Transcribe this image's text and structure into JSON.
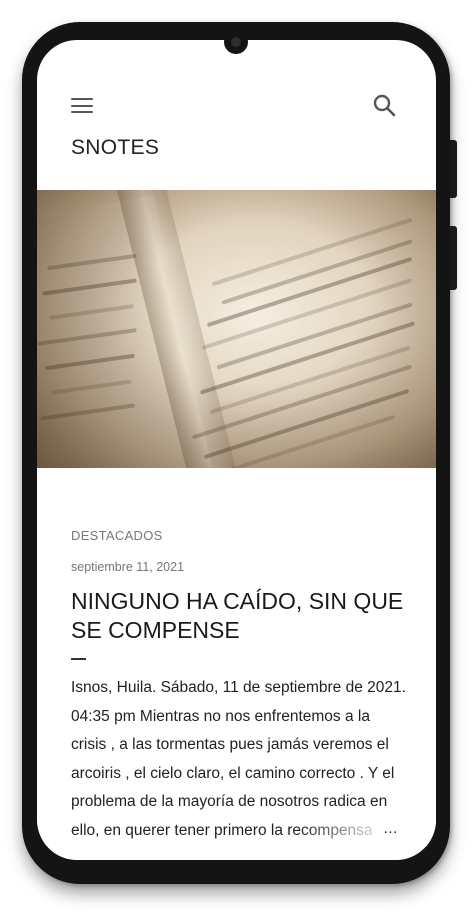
{
  "header": {
    "brand": "SNOTES",
    "menu_icon": "menu-icon",
    "search_icon": "search-icon"
  },
  "hero": {
    "image": "book-page-photo"
  },
  "post": {
    "category": "DESTACADOS",
    "date": "septiembre 11, 2021",
    "title": "NINGUNO HA CAÍDO, SIN QUE SE COMPENSE",
    "excerpt": "Isnos, Huila. Sábado, 11 de septiembre de 2021. 04:35 pm Mientras no nos enfrentemos a la crisis , a las tormentas pues jamás veremos el arcoiris , el cielo claro, el camino correcto . Y el problema de la mayoría de nosotros radica en ello, en querer tener primero la recompensa",
    "more": "…"
  }
}
